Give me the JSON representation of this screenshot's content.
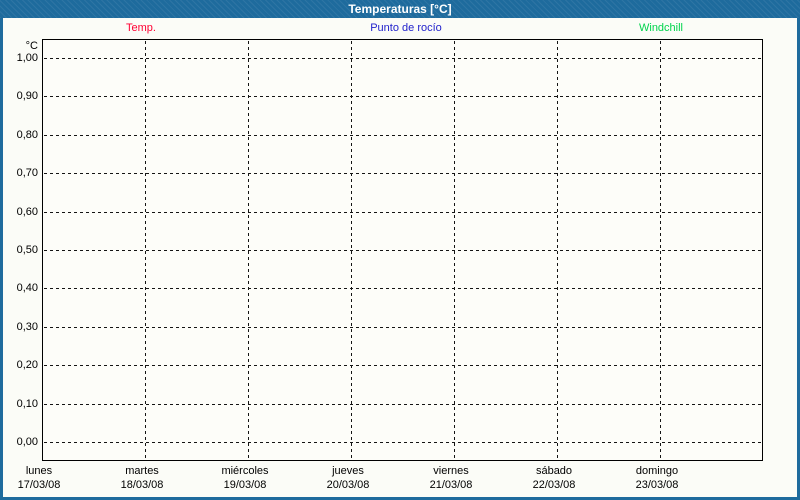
{
  "window": {
    "title": "Temperaturas [°C]"
  },
  "chart_data": {
    "type": "line",
    "title": "Temperaturas [°C]",
    "y_axis": {
      "unit_label": "°C",
      "min": 0.0,
      "max": 1.0,
      "step": 0.1,
      "tick_labels": [
        "1,00",
        "0,90",
        "0,80",
        "0,70",
        "0,60",
        "0,50",
        "0,40",
        "0,30",
        "0,20",
        "0,10",
        "0,00"
      ]
    },
    "x_axis": {
      "days": [
        {
          "name": "lunes",
          "date": "17/03/08"
        },
        {
          "name": "martes",
          "date": "18/03/08"
        },
        {
          "name": "miércoles",
          "date": "19/03/08"
        },
        {
          "name": "jueves",
          "date": "20/03/08"
        },
        {
          "name": "viernes",
          "date": "21/03/08"
        },
        {
          "name": "sábado",
          "date": "22/03/08"
        },
        {
          "name": "domingo",
          "date": "23/03/08"
        }
      ]
    },
    "grid": "dashed",
    "legend_position": "top",
    "series": [
      {
        "name": "Temp.",
        "color": "#ff0033",
        "values": []
      },
      {
        "name": "Punto de rocío",
        "color": "#2222cc",
        "values": []
      },
      {
        "name": "Windchill",
        "color": "#00d44c",
        "values": []
      }
    ]
  },
  "colors": {
    "titlebar": "#1e6b9d",
    "frame_border": "#1e6b9d",
    "grid": "#141414",
    "background": "#fbfcf7"
  }
}
